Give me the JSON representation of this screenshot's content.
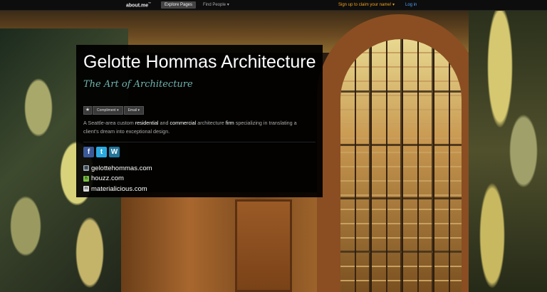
{
  "topbar": {
    "logo": "about.me",
    "logo_mark": "™",
    "explore_label": "Explore Pages",
    "find_label": "Find People",
    "signup_label": "Sign up to claim your name!",
    "login_label": "Log in"
  },
  "profile": {
    "name": "Gelotte Hommas Architecture",
    "tagline": "The Art of Architecture",
    "actions": {
      "star_icon": "star-icon",
      "compliment_label": "Compliment",
      "email_label": "Email"
    },
    "bio": {
      "p1": "A Seattle-area custom ",
      "k1": "residential",
      "p2": " and ",
      "k2": "commercial",
      "p3": " architecture ",
      "k3": "firm",
      "p4": " specializing in translating a client's dream into exceptional design."
    },
    "social": [
      {
        "name": "facebook-icon",
        "glyph": "f",
        "color": "#3b5998"
      },
      {
        "name": "twitter-icon",
        "glyph": "t",
        "color": "#2aa9e0"
      },
      {
        "name": "wordpress-icon",
        "glyph": "W",
        "color": "#21759b"
      }
    ],
    "links": [
      {
        "icon": "gelotte-site-icon",
        "glyph": "▦",
        "color": "#9ab",
        "label": "gelottehommas.com"
      },
      {
        "icon": "houzz-icon",
        "glyph": "h",
        "color": "#7ac142",
        "label": "houzz.com"
      },
      {
        "icon": "materialicious-icon",
        "glyph": "m",
        "color": "#ddd",
        "label": "materialicious.com"
      }
    ]
  }
}
